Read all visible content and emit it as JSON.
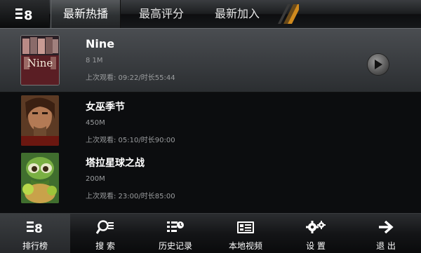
{
  "tabs": [
    {
      "label": "最新热播"
    },
    {
      "label": "最高评分"
    },
    {
      "label": "最新加入"
    }
  ],
  "movies": [
    {
      "title": "Nine",
      "size": "8 1M",
      "last_watched": "上次观看: 09:22/时长55:44",
      "poster_text": "Nine"
    },
    {
      "title": "女巫季节",
      "size": "450M",
      "last_watched": "上次观看: 05:10/时长90:00"
    },
    {
      "title": "塔拉星球之战",
      "size": "200M",
      "last_watched": "上次观看: 23:00/时长85:00"
    }
  ],
  "nav": [
    {
      "label": "排行榜",
      "icon": "ranking-icon"
    },
    {
      "label": "搜 索",
      "icon": "search-icon"
    },
    {
      "label": "历史记录",
      "icon": "history-icon"
    },
    {
      "label": "本地视频",
      "icon": "local-video-icon"
    },
    {
      "label": "设 置",
      "icon": "settings-icon"
    },
    {
      "label": "退 出",
      "icon": "exit-arrow-icon"
    }
  ],
  "colors": {
    "selected_row": "#3c3f43",
    "background": "#0c0d0f",
    "accent_slash": "#d08a1e"
  }
}
